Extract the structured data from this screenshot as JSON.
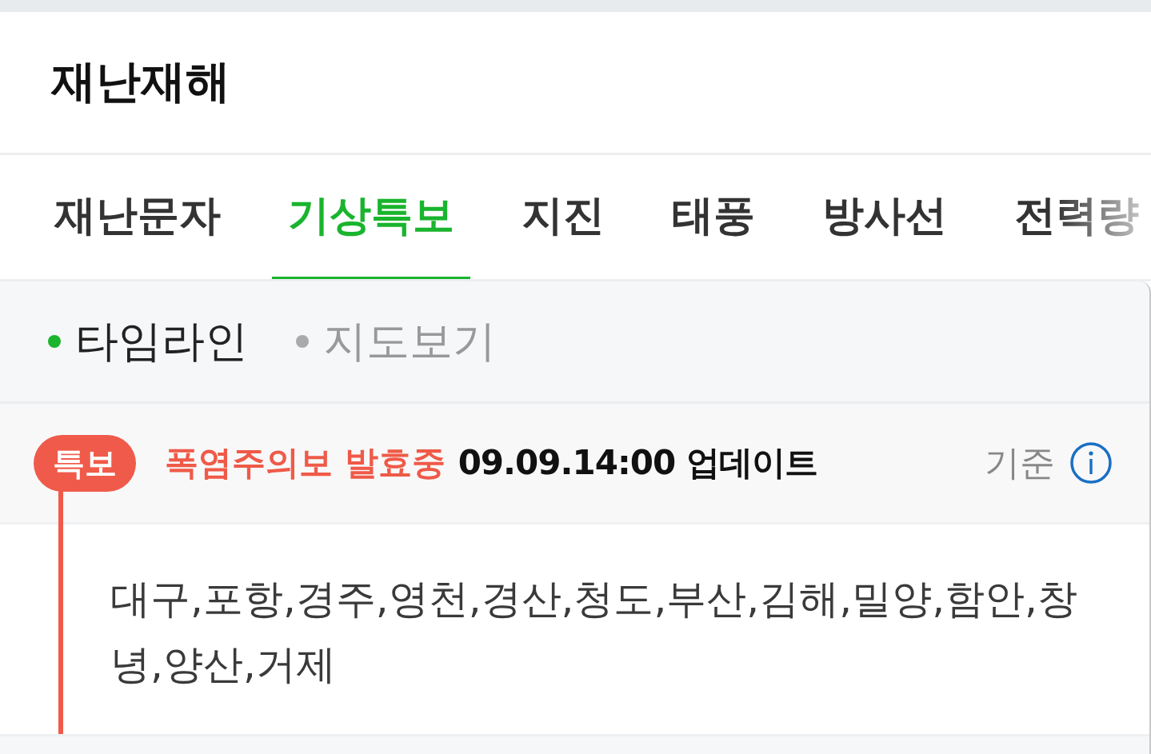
{
  "header": {
    "title": "재난재해"
  },
  "tabs": [
    {
      "label": "재난문자",
      "selected": false
    },
    {
      "label": "기상특보",
      "selected": true
    },
    {
      "label": "지진",
      "selected": false
    },
    {
      "label": "태풍",
      "selected": false
    },
    {
      "label": "방사선",
      "selected": false
    },
    {
      "label": "전력량",
      "selected": false
    }
  ],
  "view_modes": [
    {
      "label": "타임라인",
      "selected": true
    },
    {
      "label": "지도보기",
      "selected": false
    }
  ],
  "timeline": [
    {
      "badge": "특보",
      "alert": "폭염주의보 발효중",
      "updated": "09.09.14:00 업데이트",
      "basis": "기준",
      "regions": "대구,포항,경주,영천,경산,청도,부산,김해,밀양,함안,창녕,양산,거제"
    }
  ]
}
